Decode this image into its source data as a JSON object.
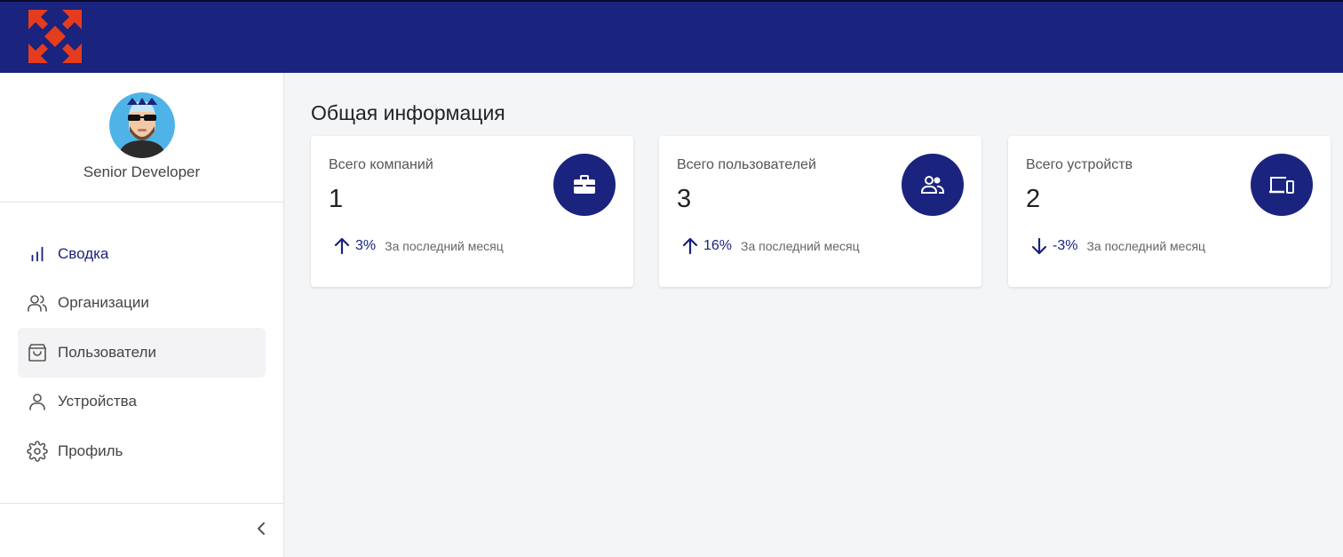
{
  "header": {
    "logo_icon": "red-diamond-cross-logo",
    "brand_color": "#1a237e",
    "accent_color": "#e53c1d"
  },
  "user": {
    "role": "Senior Developer",
    "avatar": "bearded-developer-avatar"
  },
  "sidebar": {
    "items": [
      {
        "label": "Сводка",
        "icon": "bar-chart-icon",
        "active": true
      },
      {
        "label": "Организации",
        "icon": "users-icon",
        "active": false
      },
      {
        "label": "Пользователи",
        "icon": "shopping-bag-icon",
        "active": false
      },
      {
        "label": "Устройства",
        "icon": "user-icon",
        "active": false
      },
      {
        "label": "Профиль",
        "icon": "gear-icon",
        "active": false
      }
    ],
    "collapse_icon": "chevron-left-icon"
  },
  "main": {
    "title": "Общая информация",
    "cards": [
      {
        "label": "Всего компаний",
        "value": "1",
        "trend": "3%",
        "direction": "up",
        "note": "За последний месяц",
        "icon": "briefcase-icon"
      },
      {
        "label": "Всего пользователей",
        "value": "3",
        "trend": "16%",
        "direction": "up",
        "note": "За последний месяц",
        "icon": "people-icon"
      },
      {
        "label": "Всего устройств",
        "value": "2",
        "trend": "-3%",
        "direction": "down",
        "note": "За последний месяц",
        "icon": "devices-icon"
      }
    ]
  }
}
